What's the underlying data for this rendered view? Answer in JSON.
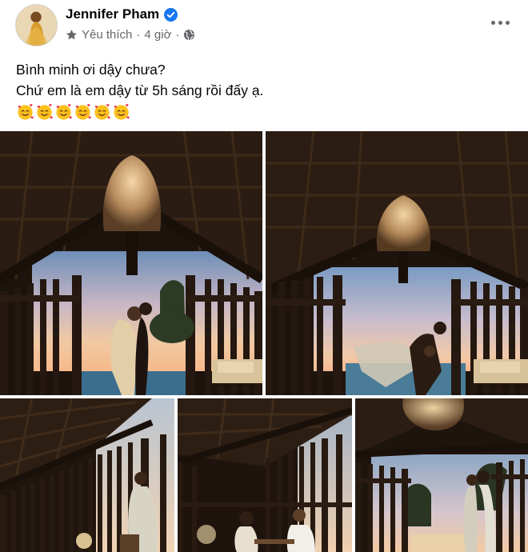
{
  "post": {
    "author": "Jennifer Pham",
    "audience_label": "Yêu thích",
    "separator": "·",
    "time": "4 giờ",
    "line1": "Bình minh ơi dậy chưa?",
    "line2": "Chứ em là em dậy từ 5h sáng rồi đấy ạ.",
    "emoji_name": "smiling-face-with-hearts",
    "emoji_count": 6
  },
  "icons": {
    "verified": "verified-badge-icon",
    "star": "star-icon",
    "globe": "globe-icon",
    "more": "more-options-icon"
  },
  "colors": {
    "verified_blue": "#1877f2",
    "meta_gray": "#65676b",
    "text": "#050505"
  },
  "photos": [
    {
      "description_name": "couple-kiss-sunset-villa"
    },
    {
      "description_name": "couple-dancing-pool-sunset"
    },
    {
      "description_name": "woman-on-terrace"
    },
    {
      "description_name": "couple-dinner-terrace"
    },
    {
      "description_name": "couple-standing-palms"
    }
  ]
}
